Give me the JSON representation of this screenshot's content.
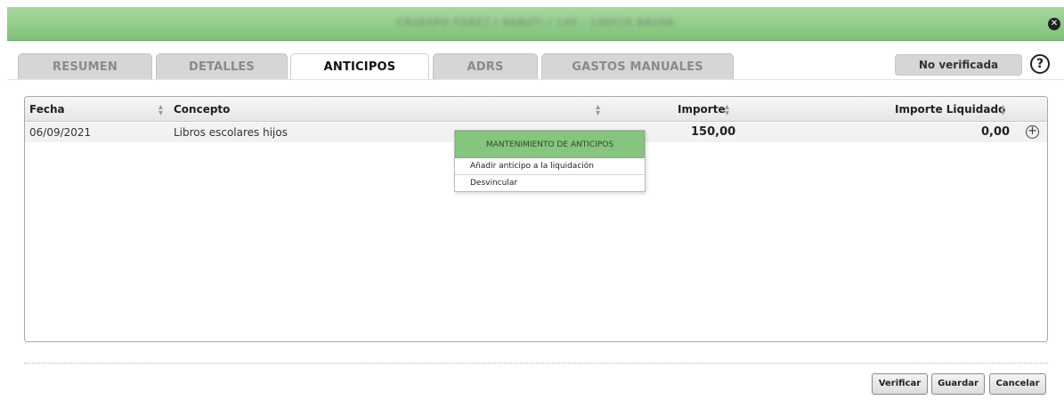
{
  "window": {
    "title": "CRUESPO FORET / RABUTI / 14X - 10EFC0 BRUSK",
    "close_icon": "x-circle-icon"
  },
  "tabs": [
    {
      "label": "RESUMEN",
      "active": false
    },
    {
      "label": "DETALLES",
      "active": false
    },
    {
      "label": "ANTICIPOS",
      "active": true
    },
    {
      "label": "ADRS",
      "active": false
    },
    {
      "label": "GASTOS MANUALES",
      "active": false
    }
  ],
  "status": {
    "label": "No verificada",
    "help_icon": "question-circle-icon"
  },
  "grid": {
    "columns": [
      {
        "label": "Fecha"
      },
      {
        "label": "Concepto"
      },
      {
        "label": "Importe"
      },
      {
        "label": "Importe Liquidado"
      }
    ],
    "rows": [
      {
        "fecha": "06/09/2021",
        "concepto": "Libros escolares hijos",
        "importe": "150,00",
        "importe_liquidado": "0,00",
        "action_icon": "plus-circle-icon"
      }
    ]
  },
  "context_menu": {
    "title": "MANTENIMIENTO DE ANTICIPOS",
    "items": [
      {
        "label": "Añadir anticipo a la liquidación"
      },
      {
        "label": "Desvincular"
      }
    ]
  },
  "footer": {
    "verificar": "Verificar",
    "guardar": "Guardar",
    "cancelar": "Cancelar"
  },
  "colors": {
    "titlebar_green": "#86c57d",
    "tab_inactive": "#d6d6d6"
  }
}
